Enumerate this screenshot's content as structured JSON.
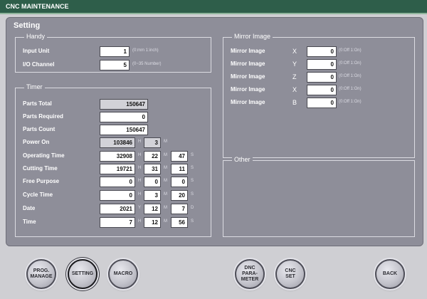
{
  "window": {
    "title": "CNC MAINTENANCE"
  },
  "section": "Setting",
  "handy": {
    "title": "Handy",
    "input_unit": {
      "label": "Input Unit",
      "value": "1",
      "hint": "(0:mm 1:inch)"
    },
    "io_channel": {
      "label": "I/O Channel",
      "value": "5",
      "hint": "(0~35 Number)"
    }
  },
  "timer": {
    "title": "Timer",
    "parts_total": {
      "label": "Parts Total",
      "value": "150647"
    },
    "parts_required": {
      "label": "Parts Required",
      "value": "0"
    },
    "parts_count": {
      "label": "Parts Count",
      "value": "150647"
    },
    "power_on": {
      "label": "Power On",
      "h": "103846",
      "m": "3"
    },
    "operating_time": {
      "label": "Operating Time",
      "h": "32908",
      "m": "22",
      "s": "47"
    },
    "cutting_time": {
      "label": "Cutting Time",
      "h": "19721",
      "m": "31",
      "s": "11"
    },
    "free_purpose": {
      "label": "Free Purpose",
      "h": "0",
      "m": "0",
      "s": "0"
    },
    "cycle_time": {
      "label": "Cycle Time",
      "h": "0",
      "m": "3",
      "s": "20"
    },
    "date": {
      "label": "Date",
      "y": "2021",
      "m": "12",
      "d": "7"
    },
    "time": {
      "label": "Time",
      "h": "7",
      "m": "12",
      "s": "56"
    },
    "units": {
      "h": "H",
      "m": "M",
      "s": "S",
      "y": "Y",
      "d": "D"
    }
  },
  "mirror": {
    "title": "Mirror Image",
    "hint": "(0:Off 1:On)",
    "items": [
      {
        "label": "Mirror Image",
        "axis": "X",
        "value": "0"
      },
      {
        "label": "Mirror Image",
        "axis": "Y",
        "value": "0"
      },
      {
        "label": "Mirror Image",
        "axis": "Z",
        "value": "0"
      },
      {
        "label": "Mirror Image",
        "axis": "X",
        "value": "0"
      },
      {
        "label": "Mirror Image",
        "axis": "B",
        "value": "0"
      }
    ]
  },
  "other": {
    "title": "Other"
  },
  "footer": {
    "prog_manage": "PROG.\nMANAGE",
    "setting": "SETTING",
    "macro": "MACRO",
    "dnc_parameter": "DNC\nPARA-\nMETER",
    "cnc_set": "CNC\nSET",
    "back": "BACK"
  },
  "colors": {
    "titlebar": "#2e5e4a",
    "panel": "#8e8e99",
    "background": "#cfcfd3"
  }
}
